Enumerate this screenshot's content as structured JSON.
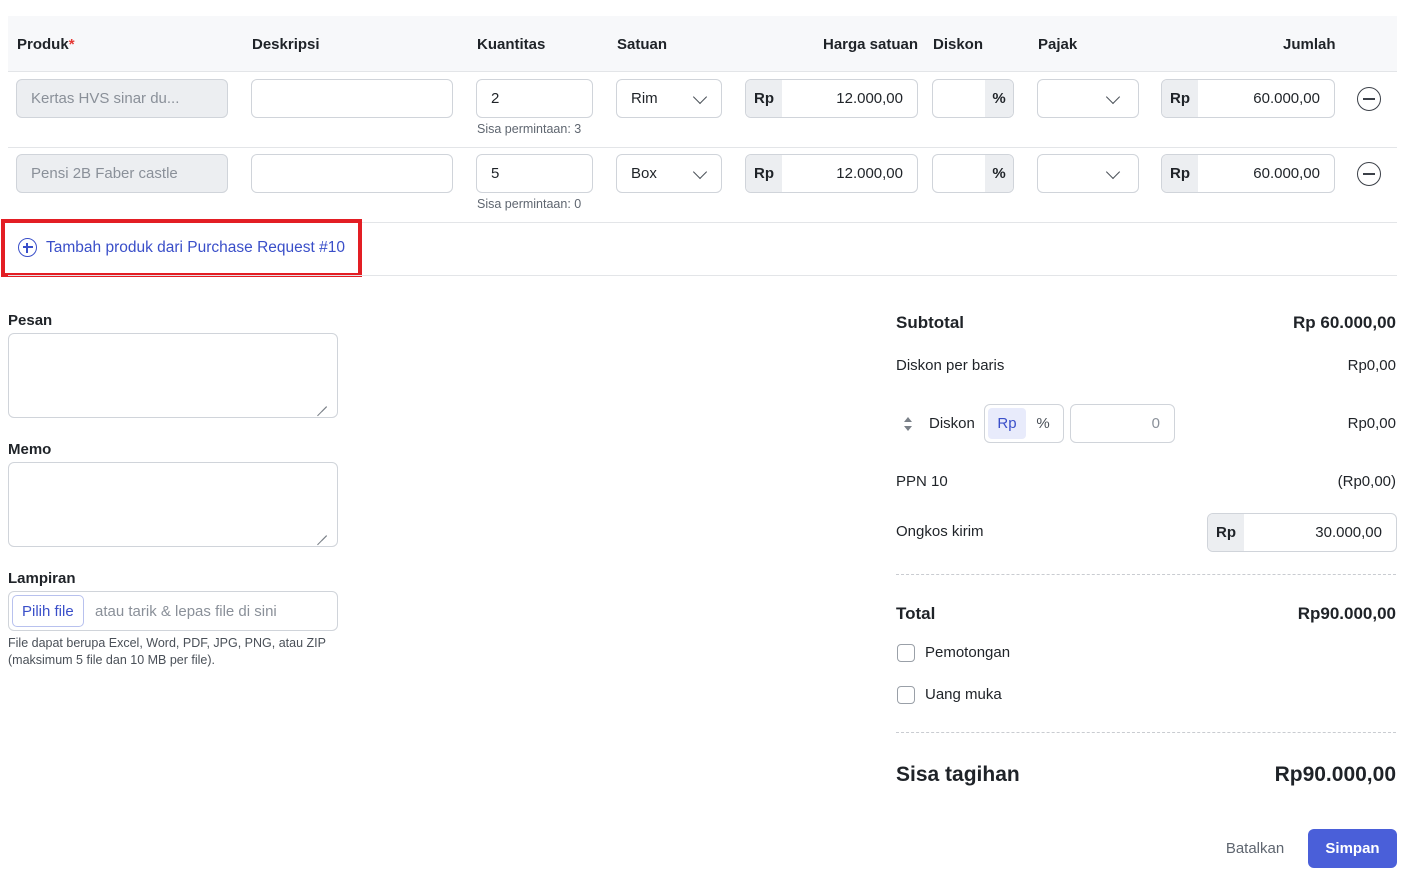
{
  "table": {
    "headers": {
      "produk": "Produk",
      "required_mark": "*",
      "deskripsi": "Deskripsi",
      "kuantitas": "Kuantitas",
      "satuan": "Satuan",
      "harga_satuan": "Harga satuan",
      "diskon": "Diskon",
      "pajak": "Pajak",
      "jumlah": "Jumlah"
    },
    "rows": [
      {
        "produk": "Kertas HVS sinar du...",
        "deskripsi": "",
        "kuantitas": "2",
        "sisa": "Sisa permintaan: 3",
        "satuan": "Rim",
        "currency": "Rp",
        "harga": "12.000,00",
        "diskon": "",
        "percent": "%",
        "pajak": "",
        "jumlah": "60.000,00"
      },
      {
        "produk": "Pensi 2B Faber castle",
        "deskripsi": "",
        "kuantitas": "5",
        "sisa": "Sisa permintaan: 0",
        "satuan": "Box",
        "currency": "Rp",
        "harga": "12.000,00",
        "diskon": "",
        "percent": "%",
        "pajak": "",
        "jumlah": "60.000,00"
      }
    ],
    "add_link": "Tambah produk dari Purchase Request #10"
  },
  "left": {
    "pesan_label": "Pesan",
    "memo_label": "Memo",
    "lampiran_label": "Lampiran",
    "file_button": "Pilih file",
    "file_placeholder": "atau tarik & lepas file di sini",
    "file_note": "File dapat berupa Excel, Word, PDF, JPG, PNG, atau ZIP (maksimum 5 file dan 10 MB per file)."
  },
  "summary": {
    "subtotal_label": "Subtotal",
    "subtotal_value": "Rp 60.000,00",
    "diskon_baris_label": "Diskon per baris",
    "diskon_baris_value": "Rp0,00",
    "diskon_label": "Diskon",
    "diskon_seg_rp": "Rp",
    "diskon_seg_pct": "%",
    "diskon_input_placeholder": "0",
    "diskon_value": "Rp0,00",
    "ppn_label": "PPN 10",
    "ppn_value": "(Rp0,00)",
    "ongkir_label": "Ongkos kirim",
    "ongkir_currency": "Rp",
    "ongkir_value": "30.000,00",
    "total_label": "Total",
    "total_value": "Rp90.000,00",
    "pemotongan_label": "Pemotongan",
    "uang_muka_label": "Uang muka",
    "sisa_label": "Sisa tagihan",
    "sisa_value": "Rp90.000,00"
  },
  "actions": {
    "cancel": "Batalkan",
    "save": "Simpan"
  }
}
